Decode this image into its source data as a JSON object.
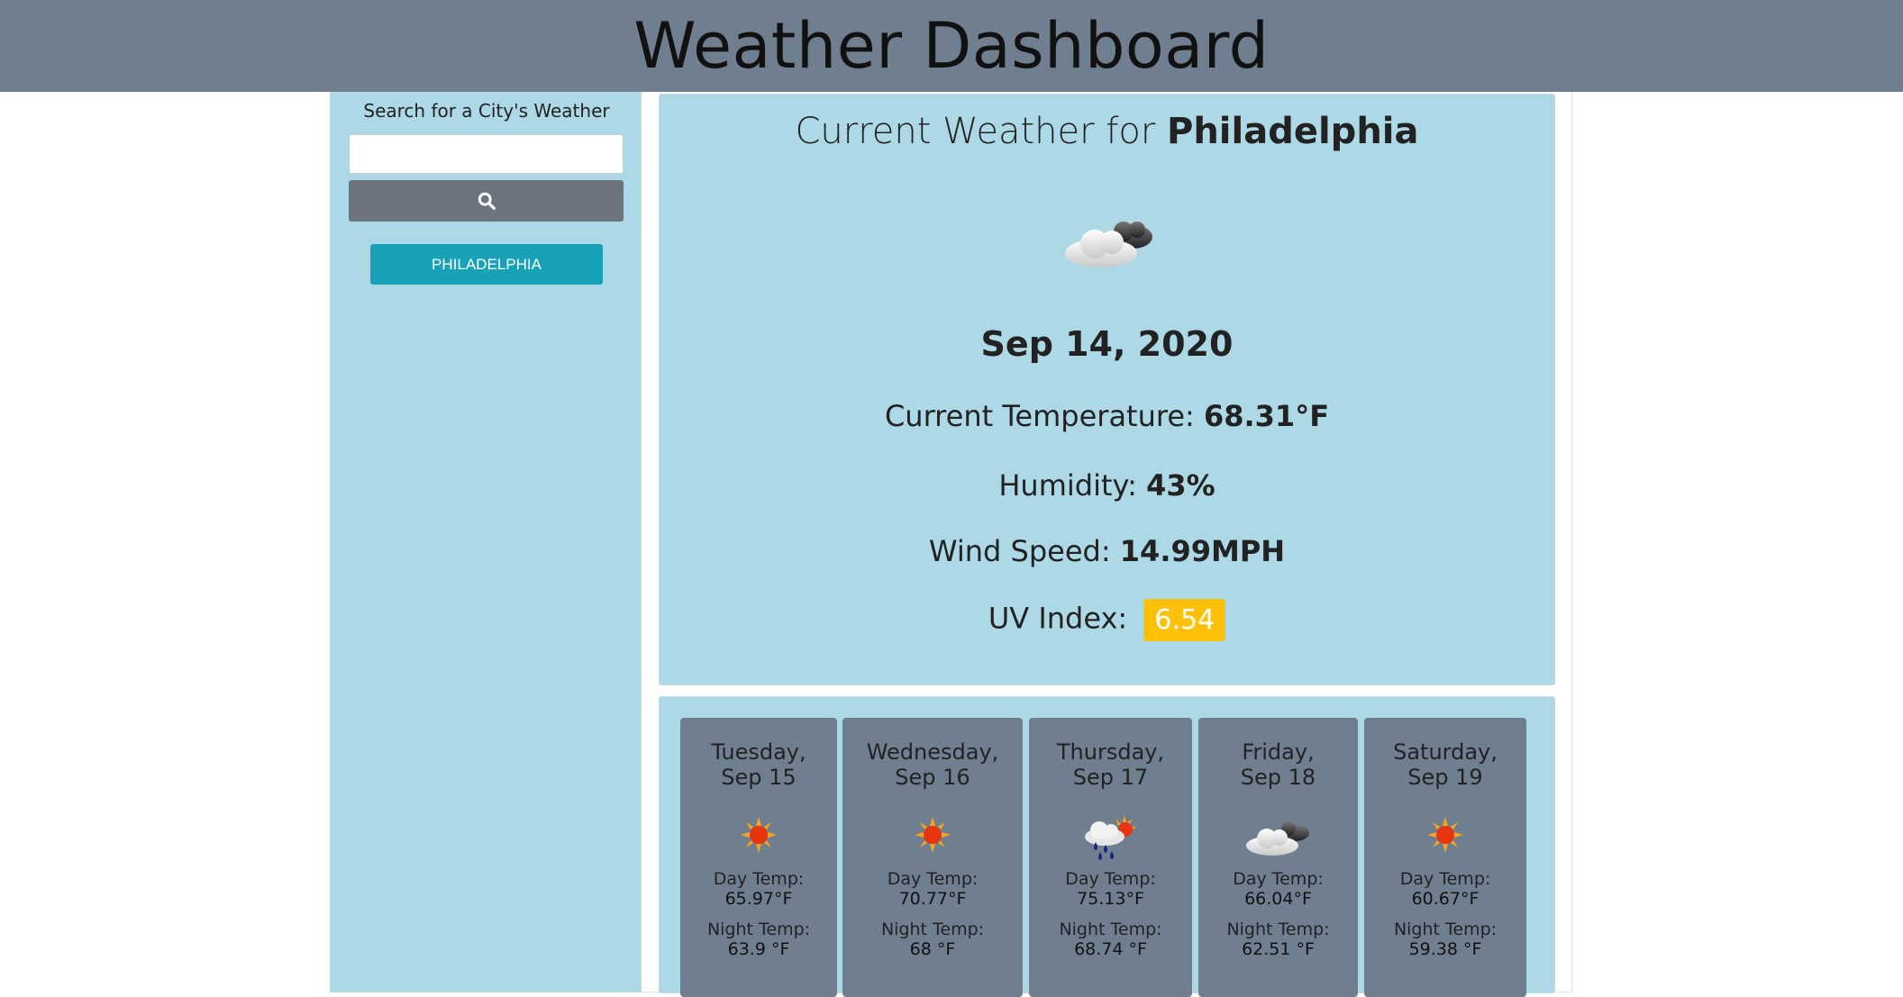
{
  "header": {
    "title": "Weather Dashboard"
  },
  "sidebar": {
    "search_label": "Search for a City's Weather",
    "search_placeholder": "",
    "history": [
      "PHILADELPHIA"
    ]
  },
  "current": {
    "title_prefix": "Current Weather for ",
    "city": "Philadelphia",
    "icon": "cloudy-icon",
    "date": "Sep 14, 2020",
    "temp_label": "Current Temperature: ",
    "temp_value": "68.31°F",
    "humidity_label": "Humidity: ",
    "humidity_value": "43%",
    "wind_label": "Wind Speed: ",
    "wind_value": "14.99MPH",
    "uv_label": "UV Index: ",
    "uv_value": "6.54",
    "uv_color": "#ffc107"
  },
  "forecast": [
    {
      "day": "Tuesday,",
      "date": "Sep 15",
      "icon": "sun-icon",
      "day_label": "Day Temp:",
      "day_temp": "65.97°F",
      "night_label": "Night Temp:",
      "night_temp": "63.9 °F"
    },
    {
      "day": "Wednesday,",
      "date": "Sep 16",
      "icon": "sun-icon",
      "day_label": "Day Temp:",
      "day_temp": "70.77°F",
      "night_label": "Night Temp:",
      "night_temp": "68 °F"
    },
    {
      "day": "Thursday,",
      "date": "Sep 17",
      "icon": "rain-sun-icon",
      "day_label": "Day Temp:",
      "day_temp": "75.13°F",
      "night_label": "Night Temp:",
      "night_temp": "68.74 °F"
    },
    {
      "day": "Friday,",
      "date": "Sep 18",
      "icon": "cloudy-icon",
      "day_label": "Day Temp:",
      "day_temp": "66.04°F",
      "night_label": "Night Temp:",
      "night_temp": "62.51 °F"
    },
    {
      "day": "Saturday,",
      "date": "Sep 19",
      "icon": "sun-icon",
      "day_label": "Day Temp:",
      "day_temp": "60.67°F",
      "night_label": "Night Temp:",
      "night_temp": "59.38 °F"
    }
  ],
  "colors": {
    "header_bg": "#6f7f90",
    "panel_bg": "#add8e6",
    "search_button": "#6c757d",
    "history_button": "#17a2b8",
    "forecast_card": "#6f7f90"
  }
}
